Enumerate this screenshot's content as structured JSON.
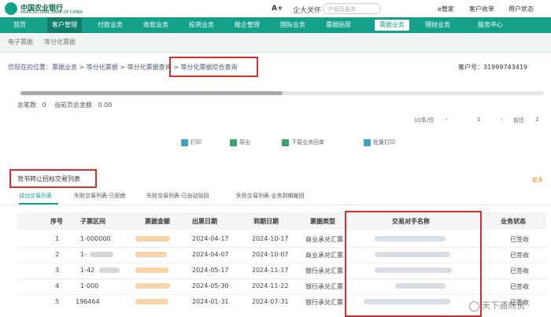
{
  "header": {
    "bank_name": "中国农业银行",
    "bank_name_en": "AGRICULTURAL BANK OF CHINA",
    "font_size_label": "A+",
    "care_label": "企大关怀",
    "search_placeholder": "产品及服务",
    "links": [
      "e管家",
      "客户收单",
      "用户状态"
    ]
  },
  "nav": {
    "items": [
      "首页",
      "客户管理",
      "付款业务",
      "收款业务",
      "投资业务",
      "账企管理",
      "国际业务",
      "票据贴现",
      "票据业务",
      "理财业务",
      "服务中心"
    ],
    "active_index": 8
  },
  "subnav": [
    "电子票据",
    "等分化票据"
  ],
  "breadcrumb": "您现在的位置：票据业务 > 等分化票据 > 等分化票据查询 > 等分化票据综合查询",
  "customer": {
    "label": "客户号：",
    "value": "31999743419"
  },
  "progress_fraction": 0.5,
  "totals": {
    "count_label": "总笔数",
    "count": "0",
    "amount_label": "当前页总金额",
    "amount": "0.00"
  },
  "pager": {
    "page_size": "10条/页",
    "current": "1",
    "jump_label": "前往",
    "jump_value": "1"
  },
  "actions": [
    "打印",
    "导出",
    "下载业务回单",
    "批量打印"
  ],
  "section_title": "背书转让招标交易列表",
  "more_label": "更多",
  "tabs": [
    "成功交易列表",
    "失败交易列表-已拒绝",
    "失败交易列表-已自动驳回",
    "失败交易列表-业务到期撤回"
  ],
  "table": {
    "headers": [
      "序号",
      "子票区间",
      "票据金额",
      "出票日期",
      "到期日期",
      "票据类型",
      "交易对手名称",
      "业务状态"
    ],
    "rows": [
      {
        "no": "1",
        "range": "1-000000",
        "issue": "2024-04-17",
        "due": "2024-10-17",
        "type": "商业承兑汇票",
        "status": "已签收"
      },
      {
        "no": "2",
        "range": "1-",
        "issue": "2024-04-07",
        "due": "2024-10-07",
        "type": "商业承兑汇票",
        "status": "已签收"
      },
      {
        "no": "3",
        "range": "1-42",
        "issue": "2024-05-17",
        "due": "2024-11-17",
        "type": "银行承兑汇票",
        "status": "已签收"
      },
      {
        "no": "4",
        "range": "1-000",
        "issue": "2024-05-30",
        "due": "2024-11-22",
        "type": "银行承兑汇票",
        "status": "已签收"
      },
      {
        "no": "5",
        "range": "196464",
        "issue": "2024-01-31",
        "due": "2024-07-31",
        "type": "银行承兑汇票",
        "status": "已签收"
      }
    ]
  },
  "watermark": "天下通商贸",
  "colors": {
    "brand": "#14a08a",
    "highlight": "#d62d2d"
  }
}
